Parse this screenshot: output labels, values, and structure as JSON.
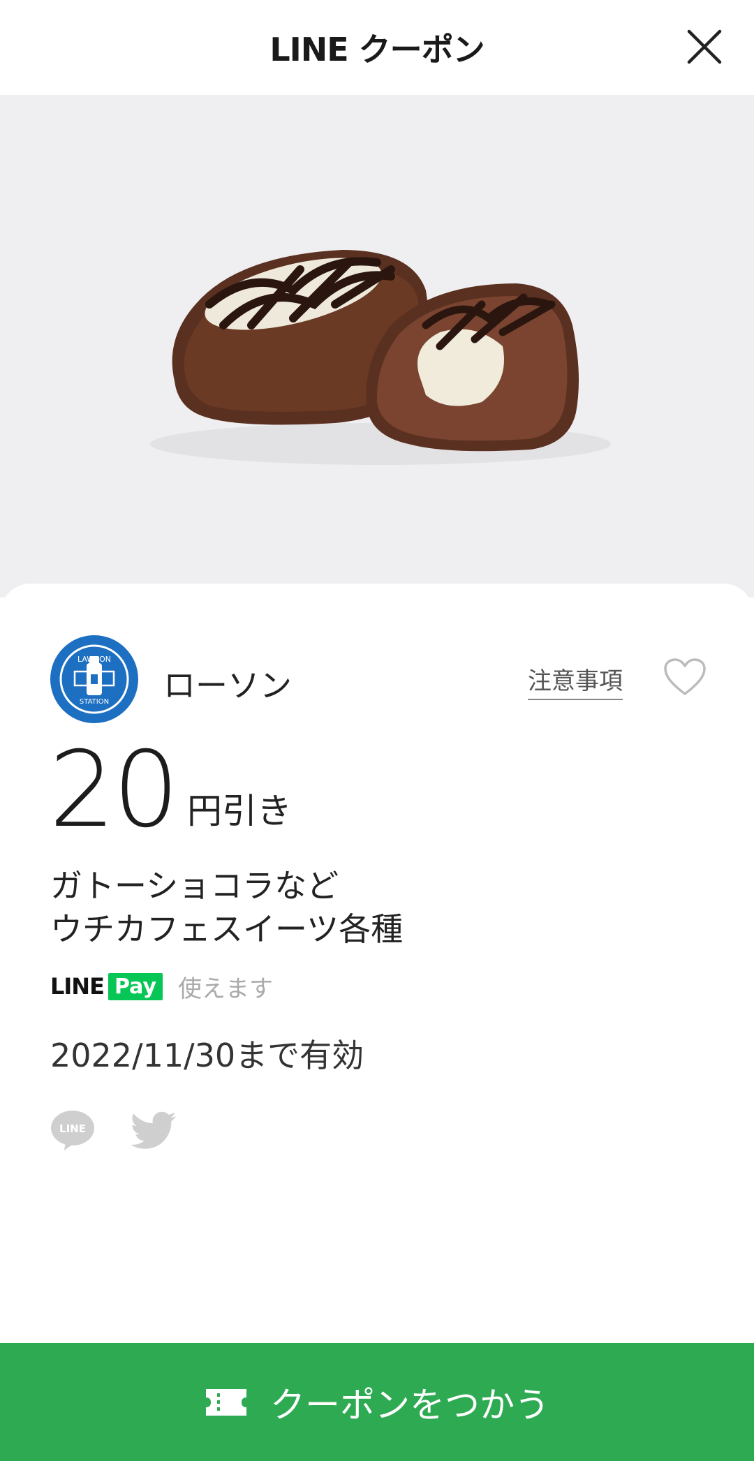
{
  "header": {
    "title": "LINE クーポン"
  },
  "store": {
    "name": "ローソン",
    "logo_top": "LAWSON",
    "logo_bottom": "STATION",
    "notes_link": "注意事項"
  },
  "coupon": {
    "amount": "20",
    "unit": "円引き",
    "description_line1": "ガトーショコラなど",
    "description_line2": "ウチカフェスイーツ各種",
    "pay_line": "LINE",
    "pay_badge": "Pay",
    "pay_usable": "使えます",
    "valid_until": "2022/11/30まで有効"
  },
  "share": {
    "line_label": "LINE"
  },
  "cta": {
    "label": "クーポンをつかう"
  },
  "colors": {
    "brand_green": "#2eaa52",
    "line_pay_green": "#06c755",
    "lawson_blue": "#1d6fc2",
    "hero_bg": "#efeef0"
  },
  "icons": [
    "close-icon",
    "lawson-logo",
    "heart-icon",
    "line-share-icon",
    "twitter-icon",
    "ticket-icon"
  ]
}
